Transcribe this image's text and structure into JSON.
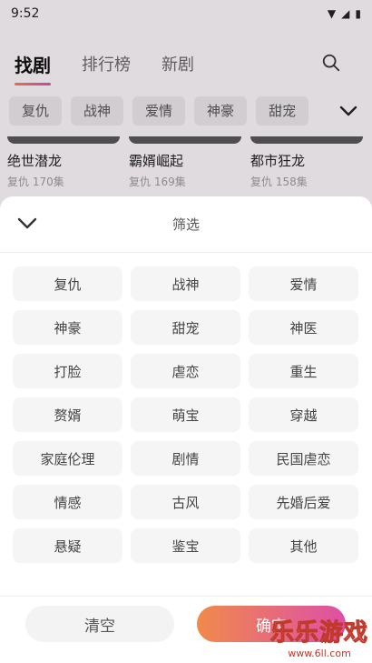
{
  "status": {
    "time": "9:52"
  },
  "header": {
    "tabs": [
      {
        "label": "找剧",
        "active": true
      },
      {
        "label": "排行榜",
        "active": false
      },
      {
        "label": "新剧",
        "active": false
      }
    ]
  },
  "chips": [
    "复仇",
    "战神",
    "爱情",
    "神豪",
    "甜宠"
  ],
  "cards": [
    {
      "title": "绝世潜龙",
      "sub": "复仇 170集"
    },
    {
      "title": "霸婿崛起",
      "sub": "复仇 169集"
    },
    {
      "title": "都市狂龙",
      "sub": "复仇 158集"
    }
  ],
  "sheet": {
    "title": "筛选",
    "options": [
      "复仇",
      "战神",
      "爱情",
      "神豪",
      "甜宠",
      "神医",
      "打脸",
      "虐恋",
      "重生",
      "赘婿",
      "萌宝",
      "穿越",
      "家庭伦理",
      "剧情",
      "民国虐恋",
      "情感",
      "古风",
      "先婚后爱",
      "悬疑",
      "鉴宝",
      "其他"
    ],
    "clear_label": "清空",
    "confirm_label": "确定"
  },
  "watermark": {
    "text": "乐乐游戏",
    "url": "www.6ll.com"
  },
  "colors": {
    "accent_start": "#f08a4b",
    "accent_end": "#de4fa7"
  }
}
